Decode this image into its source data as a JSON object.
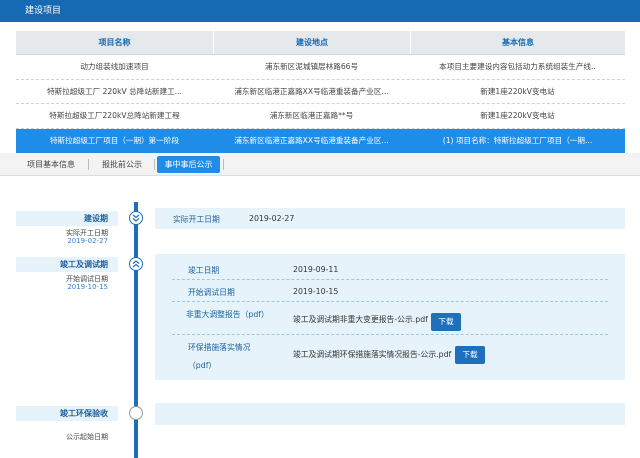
{
  "header": {
    "title": "建设项目"
  },
  "table": {
    "columns": [
      "项目名称",
      "建设地点",
      "基本信息"
    ],
    "rows": [
      [
        "动力组装线加速项目",
        "浦东新区泥城镇层林路66号",
        "本项目主要建设内容包括动力系统组装生产线.."
      ],
      [
        "特斯拉超级工厂 220kV 总降站新建工...",
        "浦东新区临港正嘉路XX号临港重装备产业区...",
        "新建1座220kV变电站"
      ],
      [
        "特斯拉超级工厂220kV总降站新建工程",
        "浦东新区临港正嘉路**号",
        "新建1座220kV变电站"
      ],
      [
        "特斯拉超级工厂项目（一期）第一阶段",
        "浦东新区临港正嘉路XX号临港重装备产业区...",
        "(1) 项目名称：特斯拉超级工厂项目（一期..."
      ]
    ]
  },
  "tabs": [
    "项目基本信息",
    "报批前公示",
    "事中事后公示"
  ],
  "timeline": {
    "phase1": {
      "title": "建设期",
      "sub": "实际开工日期",
      "date": "2019-02-27",
      "label": "实际开工日期",
      "value": "2019-02-27",
      "icon": "double-chevron-down"
    },
    "phase2": {
      "title": "竣工及调试期",
      "sub": "开始调试日期",
      "date": "2019-10-15",
      "icon": "double-chevron-up",
      "done_label": "竣工日期",
      "done_value": "2019-09-11",
      "debug_label": "开始调试日期",
      "debug_value": "2019-10-15",
      "report1_label": "非重大调整报告（pdf）",
      "report1_file": "竣工及调试期非重大变更报告-公示.pdf",
      "report2_label": "环保措施落实情况",
      "report2_label2": "（pdf）",
      "report2_file": "竣工及调试期环保措施落实情况报告-公示.pdf",
      "download": "下载"
    },
    "phase3": {
      "title": "竣工环保验收",
      "sub": "公示起始日期"
    }
  },
  "colors": {
    "brand": "#1669b3",
    "selected_row": "#1f8de8",
    "panel": "#e6f3fb"
  }
}
